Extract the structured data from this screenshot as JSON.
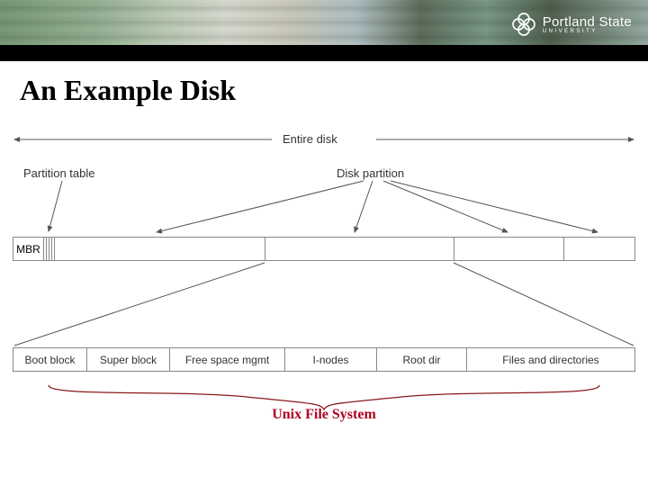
{
  "university": {
    "name": "Portland State",
    "sub": "UNIVERSITY"
  },
  "slide": {
    "title": "An Example Disk"
  },
  "labels": {
    "entire_disk": "Entire disk",
    "partition_table": "Partition table",
    "disk_partition": "Disk partition",
    "mbr": "MBR"
  },
  "sub_cells": {
    "boot": "Boot block",
    "super": "Super block",
    "free": "Free space mgmt",
    "inodes": "I-nodes",
    "root": "Root dir",
    "files": "Files and directories"
  },
  "annotation": {
    "ufs": "Unix File System"
  }
}
